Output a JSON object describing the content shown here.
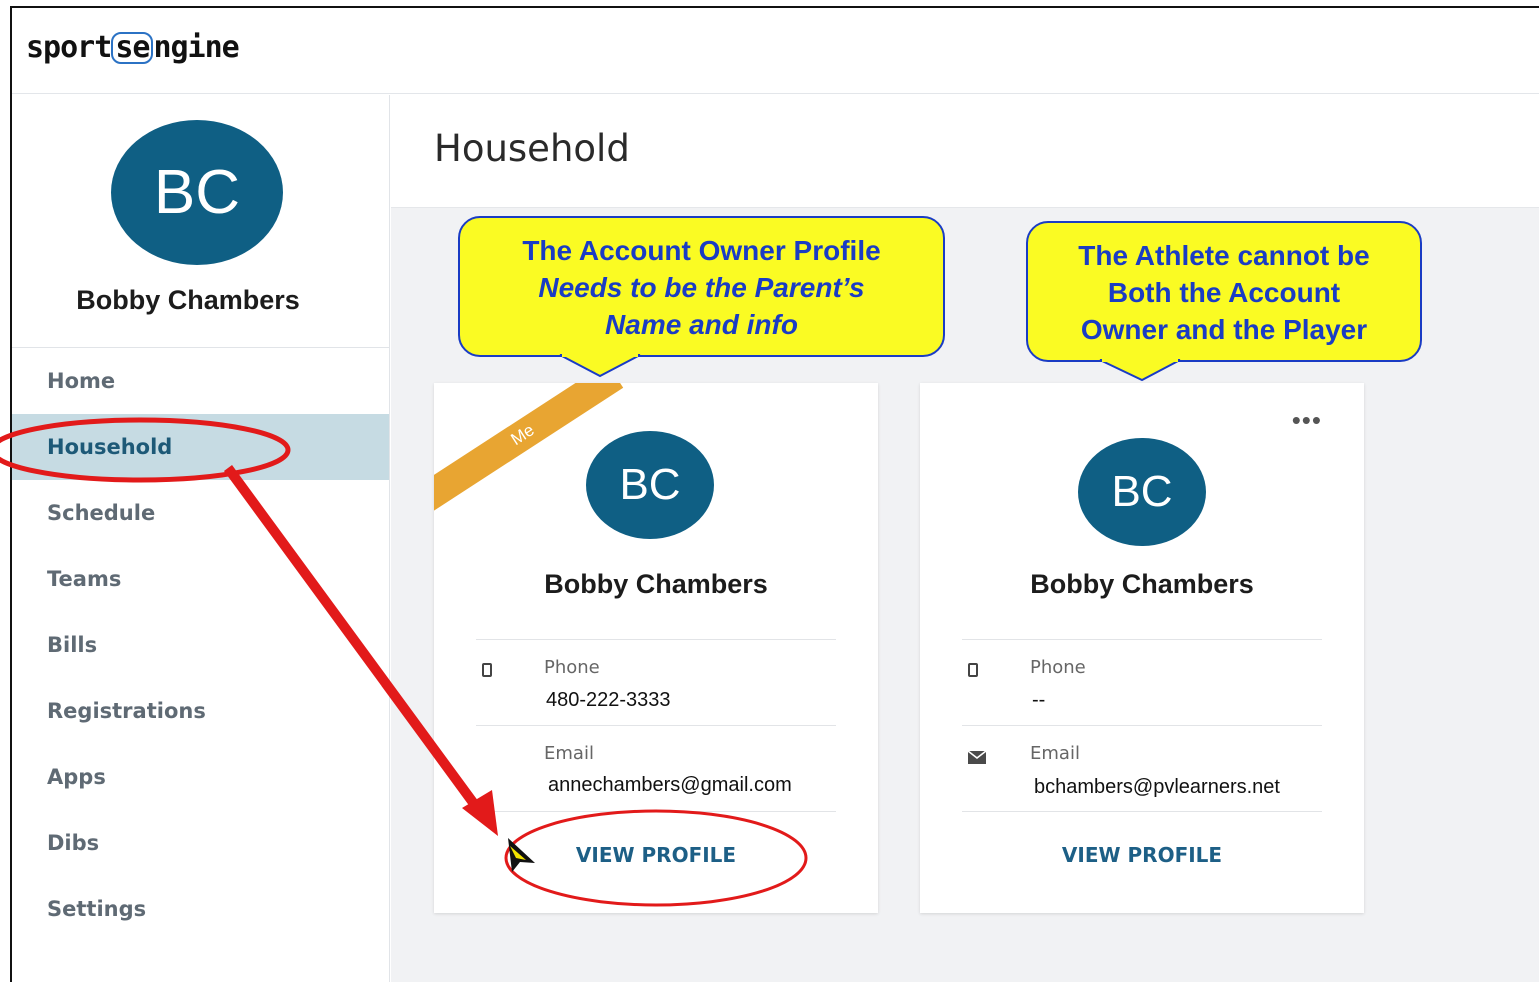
{
  "brand": {
    "logo_prefix": "sport",
    "logo_mark": "se",
    "logo_suffix": "ngine"
  },
  "user": {
    "initials": "BC",
    "name": "Bobby Chambers"
  },
  "nav": {
    "items": [
      {
        "label": "Home"
      },
      {
        "label": "Household"
      },
      {
        "label": "Schedule"
      },
      {
        "label": "Teams"
      },
      {
        "label": "Bills"
      },
      {
        "label": "Registrations"
      },
      {
        "label": "Apps"
      },
      {
        "label": "Dibs"
      },
      {
        "label": "Settings"
      }
    ],
    "active": "Household"
  },
  "page": {
    "title": "Household"
  },
  "cards": [
    {
      "badge": "Me",
      "initials": "BC",
      "name": "Bobby Chambers",
      "phone_label": "Phone",
      "phone": "480-222-3333",
      "email_label": "Email",
      "email": "annechambers@gmail.com",
      "action": "VIEW PROFILE"
    },
    {
      "menu": "•••",
      "initials": "BC",
      "name": "Bobby Chambers",
      "phone_label": "Phone",
      "phone": "--",
      "email_label": "Email",
      "email": "bchambers@pvlearners.net",
      "action": "VIEW PROFILE"
    }
  ],
  "annotations": {
    "callout1": {
      "line1": "The Account Owner Profile",
      "line2": "Needs to be the Parent’s",
      "line3": "Name and info"
    },
    "callout2": {
      "line1": "The Athlete cannot be",
      "line2": "Both the Account",
      "line3": "Owner and the Player"
    }
  },
  "colors": {
    "avatar": "#0f5f84",
    "active_nav_bg": "#c6dbe3",
    "ribbon": "#e8a532",
    "callout_bg": "#fafb23",
    "callout_text": "#1a3cc4",
    "annotation_red": "#e21a1a"
  },
  "icons": {
    "phone": "phone-icon",
    "email": "envelope-icon",
    "menu": "more-dots-icon"
  }
}
